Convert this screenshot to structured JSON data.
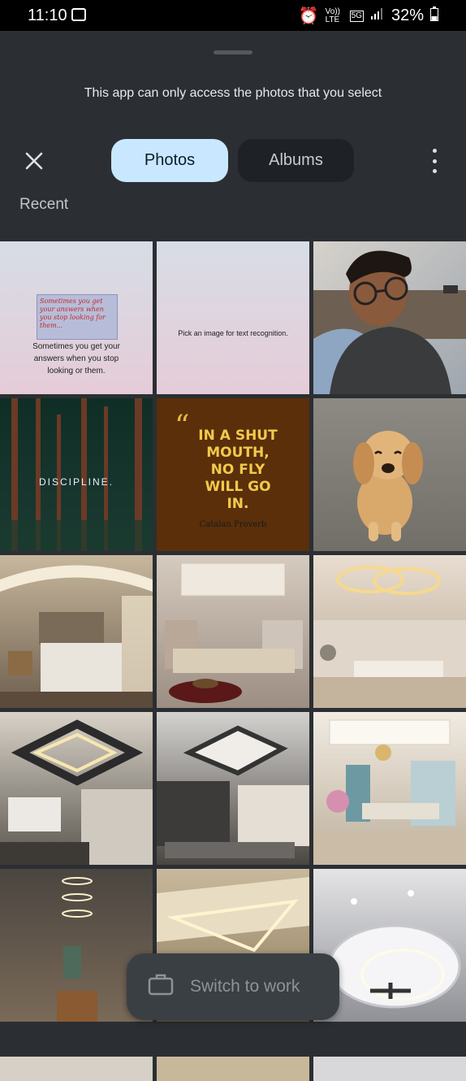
{
  "status_bar": {
    "time": "11:10",
    "volte": "Vo)) LTE",
    "network": "5G",
    "battery": "32%"
  },
  "header": {
    "banner": "This app can only access the photos that you select",
    "tabs": [
      {
        "label": "Photos",
        "selected": true
      },
      {
        "label": "Albums",
        "selected": false
      }
    ],
    "icons": {
      "close": "close-icon",
      "more": "more-vert-icon"
    }
  },
  "section_title": "Recent",
  "photos": [
    {
      "quote": "Sometimes you get your answers when you stop looking for them...",
      "caption": "Sometimes you get your answers when you stop looking or them."
    },
    {
      "caption": "Pick an image for text recognition."
    },
    {
      "desc": "selfie"
    },
    {
      "text": "DISCIPLINE."
    },
    {
      "lines": [
        "IN A SHUT",
        "MOUTH,",
        "NO FLY",
        "WILL GO",
        "IN."
      ],
      "attribution": "Catalan Proverb"
    },
    {
      "desc": "puppy"
    }
  ],
  "switch_button": {
    "label": "Switch to work",
    "icon": "briefcase-icon"
  }
}
